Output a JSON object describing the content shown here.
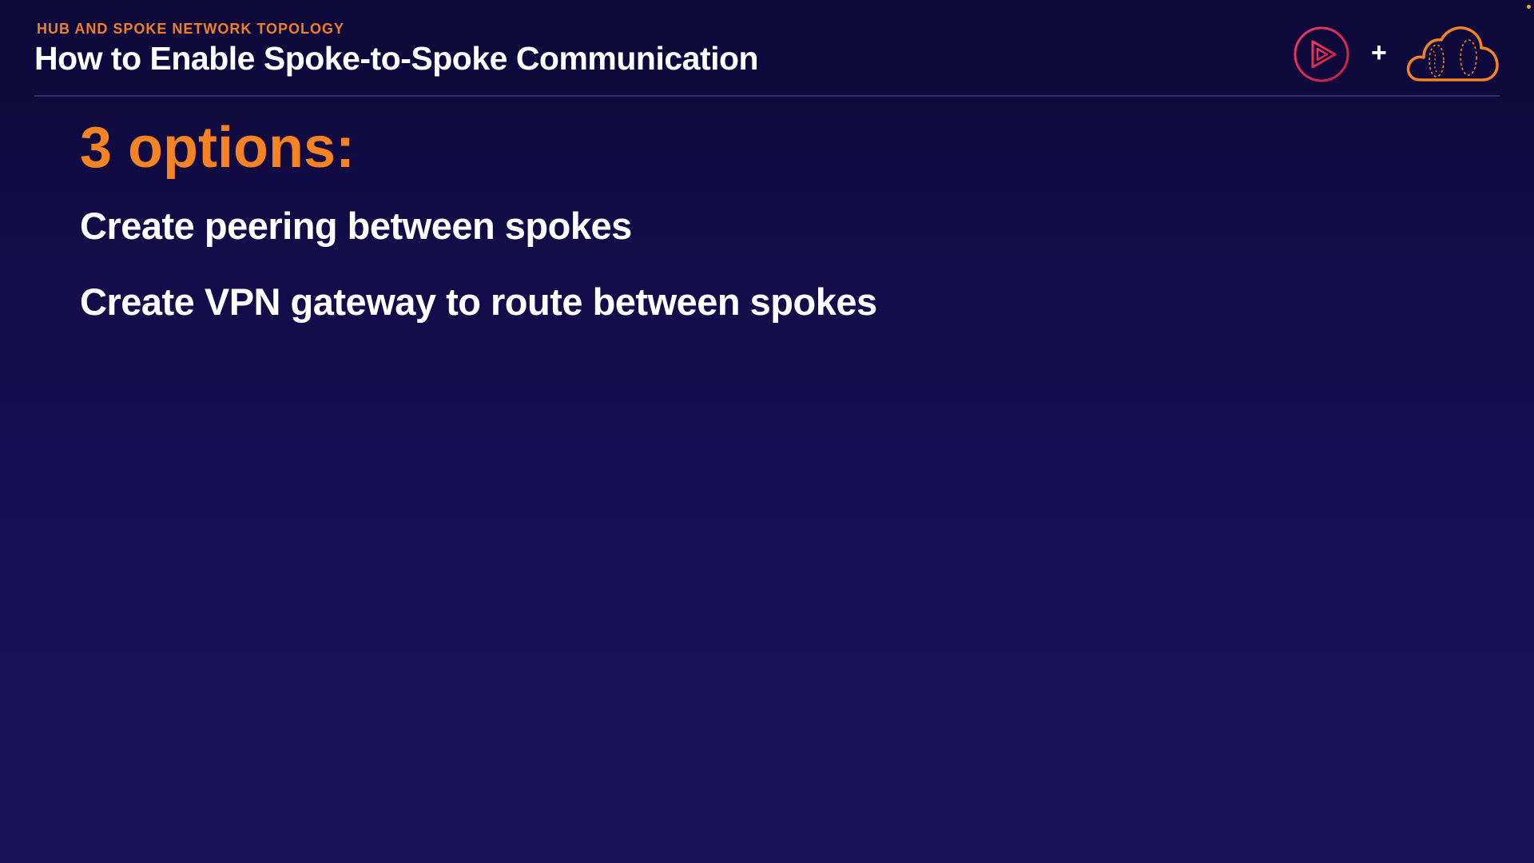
{
  "header": {
    "eyebrow": "HUB AND SPOKE NETWORK TOPOLOGY",
    "title": "How to Enable Spoke-to-Spoke Communication",
    "plus": "+",
    "logos": [
      "play-logo-icon",
      "cloud-logo-icon"
    ]
  },
  "content": {
    "heading": "3 options:",
    "options": [
      "Create peering between spokes",
      "Create VPN gateway to route between spokes"
    ]
  },
  "colors": {
    "background_top": "#0d0838",
    "background_bottom": "#1a1259",
    "accent_orange": "#f48423",
    "play_logo_gradient": [
      "#e0305e",
      "#c01f3a"
    ],
    "text": "#ffffff"
  }
}
